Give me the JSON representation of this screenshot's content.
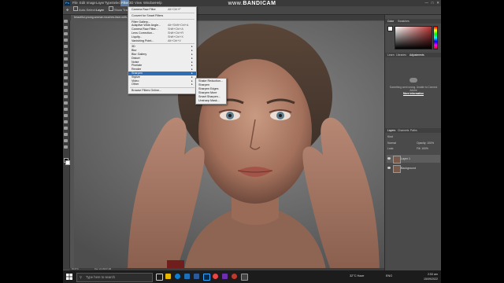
{
  "watermark": {
    "prefix": "www.",
    "brand": "BANDICAM",
    ".com": ".com"
  },
  "menubar": {
    "items": [
      "File",
      "Edit",
      "Image",
      "Layer",
      "Type",
      "Select",
      "Filter",
      "3D",
      "View",
      "Window",
      "Help"
    ],
    "active_index": 6
  },
  "options_bar": {
    "auto_select_label": "Auto-Select:",
    "layer_value": "Layer",
    "show_transform_label": "Show Transform Controls"
  },
  "document_tab": {
    "title": "beautiful-young-woman-touches-face-with-hands @ 66.7% (Layer 1, RGB/8#)"
  },
  "status_bar": {
    "zoom": "66.67%",
    "doc": "Doc: 24.1M/37.2M"
  },
  "filter_menu": {
    "items": [
      {
        "label": "Camera Raw Filter",
        "shortcut": "Alt+Ctrl+F",
        "submenu": false
      },
      {
        "sep": true
      },
      {
        "label": "Convert for Smart Filters",
        "shortcut": "",
        "submenu": false
      },
      {
        "sep": true
      },
      {
        "label": "Filter Gallery...",
        "shortcut": "",
        "submenu": false
      },
      {
        "label": "Adaptive Wide Angle...",
        "shortcut": "Alt+Shift+Ctrl+A",
        "submenu": false
      },
      {
        "label": "Camera Raw Filter...",
        "shortcut": "Shift+Ctrl+A",
        "submenu": false
      },
      {
        "label": "Lens Correction...",
        "shortcut": "Shift+Ctrl+R",
        "submenu": false
      },
      {
        "label": "Liquify...",
        "shortcut": "Shift+Ctrl+X",
        "submenu": false
      },
      {
        "label": "Vanishing Point...",
        "shortcut": "Alt+Ctrl+V",
        "submenu": false
      },
      {
        "sep": true
      },
      {
        "label": "3D",
        "shortcut": "",
        "submenu": true
      },
      {
        "label": "Blur",
        "shortcut": "",
        "submenu": true
      },
      {
        "label": "Blur Gallery",
        "shortcut": "",
        "submenu": true
      },
      {
        "label": "Distort",
        "shortcut": "",
        "submenu": true
      },
      {
        "label": "Noise",
        "shortcut": "",
        "submenu": true
      },
      {
        "label": "Pixelate",
        "shortcut": "",
        "submenu": true
      },
      {
        "label": "Render",
        "shortcut": "",
        "submenu": true
      },
      {
        "label": "Sharpen",
        "shortcut": "",
        "submenu": true,
        "highlight": true
      },
      {
        "label": "Stylize",
        "shortcut": "",
        "submenu": true
      },
      {
        "label": "Video",
        "shortcut": "",
        "submenu": true
      },
      {
        "label": "Other",
        "shortcut": "",
        "submenu": true
      },
      {
        "sep": true
      },
      {
        "label": "Browse Filters Online...",
        "shortcut": "",
        "submenu": false
      }
    ]
  },
  "sharpen_submenu": {
    "items": [
      "Shake Reduction...",
      "Sharpen",
      "Sharpen Edges",
      "Sharpen More",
      "Smart Sharpen...",
      "Unsharp Mask..."
    ]
  },
  "panels": {
    "color_tabs": [
      "Color",
      "Swatches"
    ],
    "learn_tabs": [
      "Learn",
      "Libraries",
      "Adjustments"
    ],
    "learn_text": "Something went wrong. Unable to Connect Adobe",
    "learn_more": "More information",
    "layers_tabs": [
      "Layers",
      "Channels",
      "Paths"
    ],
    "kind_label": "Kind",
    "blend_mode": "Normal",
    "opacity_label": "Opacity: 100%",
    "lock_label": "Lock:",
    "fill_label": "Fill: 100%",
    "layers": [
      {
        "name": "Layer 1",
        "selected": true
      },
      {
        "name": "Background",
        "selected": false
      }
    ],
    "color_swatch": "#b83232"
  },
  "taskbar": {
    "search_placeholder": "Type here to search",
    "weather": "32°C Haze",
    "time": "2:53 am",
    "date": "15/09/2022",
    "lang": "ENG"
  }
}
